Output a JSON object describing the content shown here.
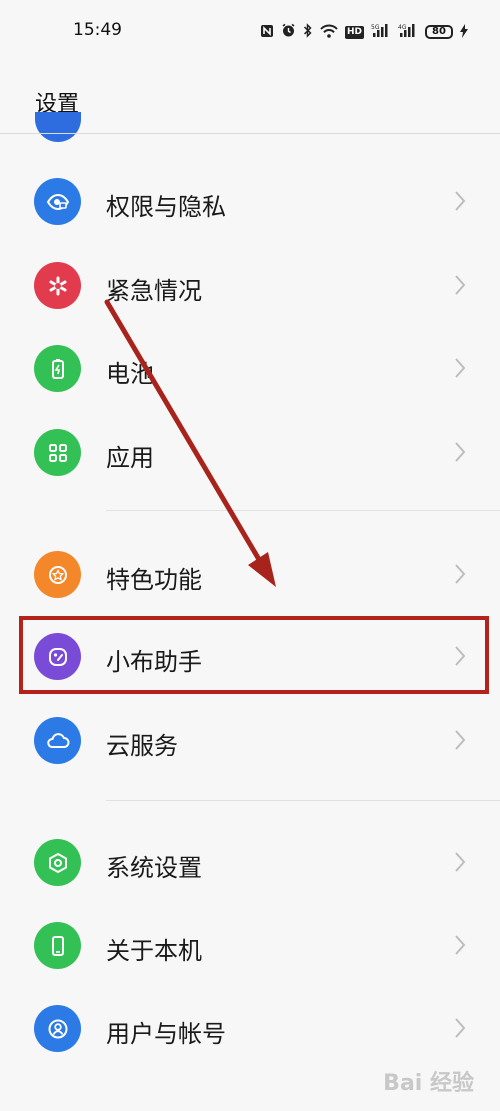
{
  "status_bar": {
    "time": "15:49",
    "hd_label": "HD",
    "signal1_label": "5G",
    "signal2_label": "4G",
    "battery_level": "80"
  },
  "header": {
    "title": "设置"
  },
  "menu": [
    {
      "label": "权限与隐私",
      "icon": "eye-lock-icon",
      "color": "#2b7ae6"
    },
    {
      "label": "紧急情况",
      "icon": "asterisk-icon",
      "color": "#e23b4e"
    },
    {
      "label": "电池",
      "icon": "battery-icon",
      "color": "#33c155"
    },
    {
      "label": "应用",
      "icon": "grid-icon",
      "color": "#33c155"
    },
    {
      "label": "特色功能",
      "icon": "star-icon",
      "color": "#f5872b"
    },
    {
      "label": "小布助手",
      "icon": "assistant-icon",
      "color": "#7a4bd6"
    },
    {
      "label": "云服务",
      "icon": "cloud-icon",
      "color": "#2b7ae6"
    },
    {
      "label": "系统设置",
      "icon": "hexagon-gear-icon",
      "color": "#33c155"
    },
    {
      "label": "关于本机",
      "icon": "phone-icon",
      "color": "#33c155"
    },
    {
      "label": "用户与帐号",
      "icon": "user-icon",
      "color": "#2b7ae6"
    }
  ],
  "watermark": {
    "text": "Bai 经验"
  },
  "accent": {
    "annotation_red": "#b3221b"
  }
}
